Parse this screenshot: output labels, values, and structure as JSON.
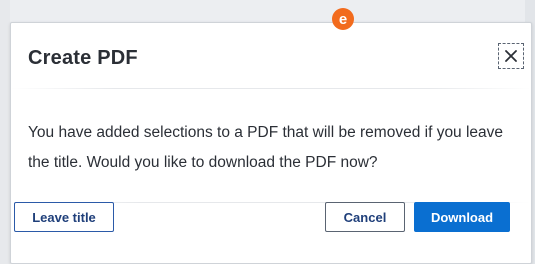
{
  "dialog": {
    "title": "Create PDF",
    "message": "You have added selections to a PDF that will be removed if you leave the title. Would you like to download the PDF now?",
    "buttons": {
      "leave": "Leave title",
      "cancel": "Cancel",
      "download": "Download"
    },
    "close_icon": "close-icon"
  },
  "annotation": {
    "badge_label": "e",
    "badge_color": "#f26b1d"
  },
  "colors": {
    "primary": "#0a6fd1",
    "outline": "#2b5aa8",
    "text": "#2b2f36"
  }
}
